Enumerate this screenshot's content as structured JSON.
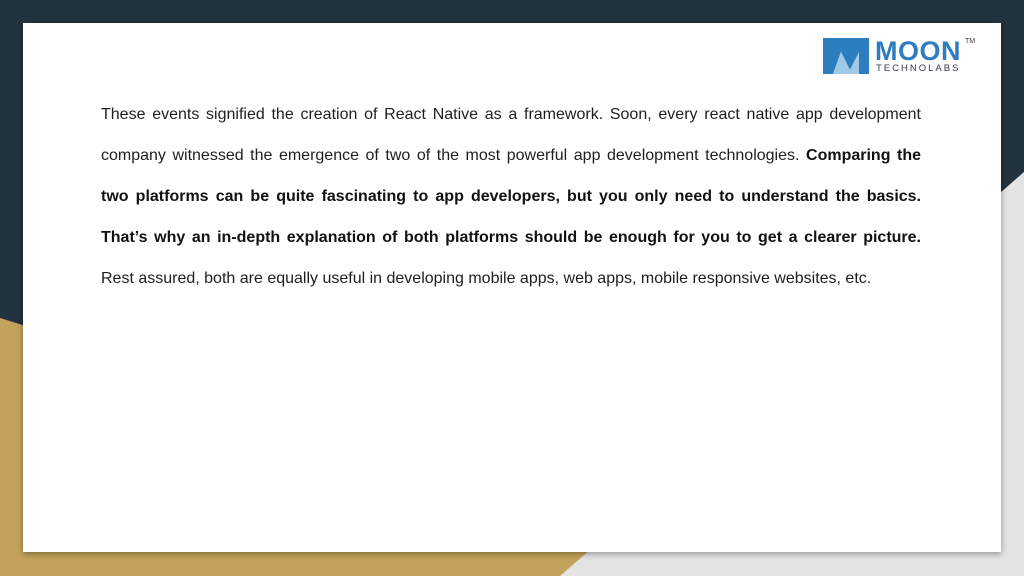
{
  "logo": {
    "word": "MOON",
    "trademark": "TM",
    "subtitle": "TECHNOLABS"
  },
  "paragraph": {
    "part1": "These events signified the creation of React Native as a framework. Soon, every react native app development company witnessed the emergence of two of the most powerful app development technologies. ",
    "bold": "Comparing the two platforms can be quite fascinating to app developers, but you only need to understand the basics. That’s why an in-depth explanation of both platforms should be enough for you to get a clearer picture.",
    "part2": " Rest assured, both are equally useful in developing mobile apps, web apps, mobile responsive websites, etc."
  },
  "colors": {
    "background_navy": "#21333f",
    "accent_gold": "#c3a35b",
    "accent_light_gray": "#e3e3e3",
    "logo_blue": "#2d7ec0",
    "logo_dark": "#2d3e4a"
  }
}
